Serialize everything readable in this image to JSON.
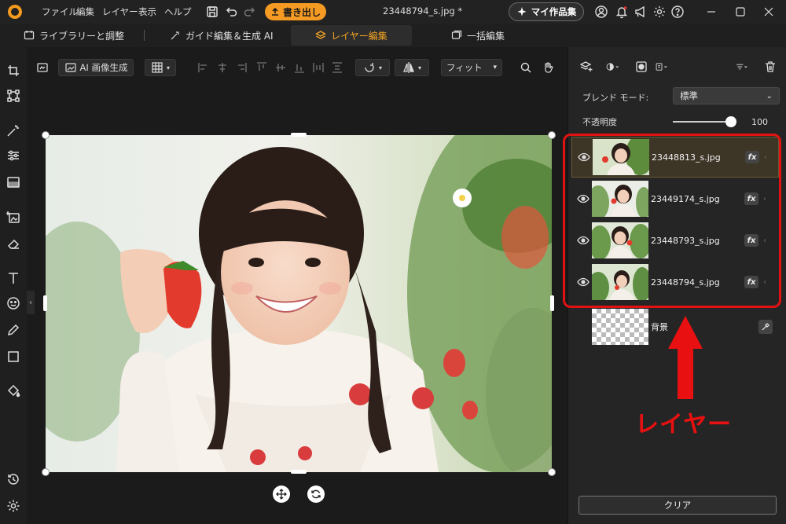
{
  "titlebar": {
    "menus": [
      "ファイル",
      "編集",
      "レイヤー",
      "表示",
      "ヘルプ"
    ],
    "export_label": "書き出し",
    "document_title": "23448794_s.jpg *",
    "my_works_label": "マイ作品集"
  },
  "modebar": {
    "tabs": [
      {
        "label": "ライブラリーと調整",
        "icon": "library-icon"
      },
      {
        "label": "ガイド編集＆生成 AI",
        "icon": "magic-wand-icon"
      },
      {
        "label": "レイヤー編集",
        "icon": "layers-icon",
        "active": true
      },
      {
        "label": "一括編集",
        "icon": "batch-images-icon"
      }
    ]
  },
  "canvasbar": {
    "ai_generate_label": "AI 画像生成",
    "fit_label": "フィット"
  },
  "panel": {
    "blend_mode_label": "ブレンド モード:",
    "blend_mode_value": "標準",
    "opacity_label": "不透明度",
    "opacity_value": "100",
    "opacity_fraction": 1.0,
    "layers": [
      {
        "name": "23448813_s.jpg",
        "fx": "fx",
        "visible": true,
        "selected": true
      },
      {
        "name": "23449174_s.jpg",
        "fx": "fx",
        "visible": true,
        "selected": false
      },
      {
        "name": "23448793_s.jpg",
        "fx": "fx",
        "visible": true,
        "selected": false
      },
      {
        "name": "23448794_s.jpg",
        "fx": "fx",
        "visible": true,
        "selected": false
      }
    ],
    "background_layer_name": "背景",
    "clear_label": "クリア"
  },
  "annotation": {
    "label": "レイヤー",
    "color": "#e81010"
  },
  "colors": {
    "accent": "#f5a623",
    "export_button": "#f59b23"
  }
}
